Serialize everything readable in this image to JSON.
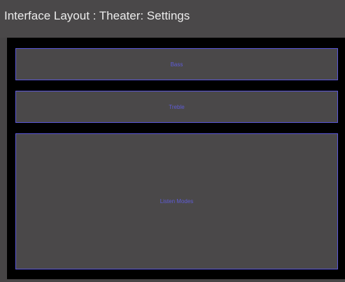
{
  "window": {
    "title": "Interface Layout : Theater: Settings"
  },
  "settings": {
    "bass_label": "Bass",
    "treble_label": "Treble",
    "listen_modes_label": "Listen Modes"
  },
  "colors": {
    "background": "#474546",
    "panel": "#000000",
    "button_fill": "#4a4849",
    "button_border": "#5a57d8",
    "button_text": "#5f5cd6",
    "title_text": "#ececec"
  }
}
